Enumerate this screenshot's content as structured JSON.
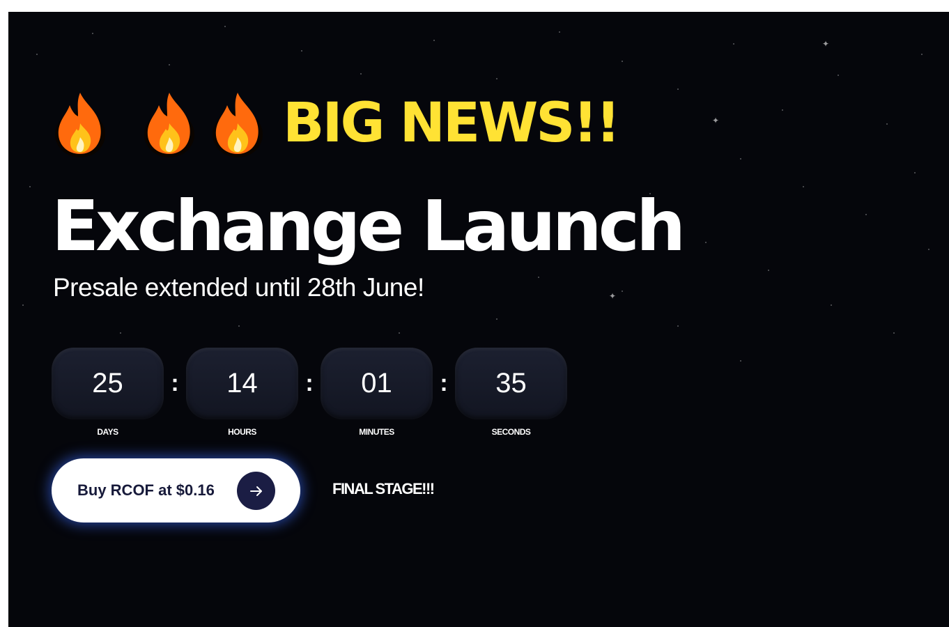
{
  "hero": {
    "headline_icons": [
      "fire-emoji",
      "fire-emoji",
      "fire-emoji"
    ],
    "headline_text": "BIG NEWS!!",
    "title": "Exchange Launch",
    "subtitle": "Presale extended until 28th June!"
  },
  "countdown": {
    "separator": ":",
    "units": [
      {
        "value": "25",
        "label": "DAYS"
      },
      {
        "value": "14",
        "label": "HOURS"
      },
      {
        "value": "01",
        "label": "MINUTES"
      },
      {
        "value": "35",
        "label": "SECONDS"
      }
    ]
  },
  "cta": {
    "buy_label": "Buy RCOF at $0.16",
    "arrow_icon": "arrow-right-icon"
  },
  "stage_text": "FINAL STAGE!!!",
  "colors": {
    "background": "#05060b",
    "headline_yellow": "#ffe234",
    "button_bg": "#ffffff",
    "button_text": "#171a3a",
    "arrow_circle": "#1b1d44",
    "button_glow": "#3c6eff",
    "countdown_box": "#161a28"
  }
}
